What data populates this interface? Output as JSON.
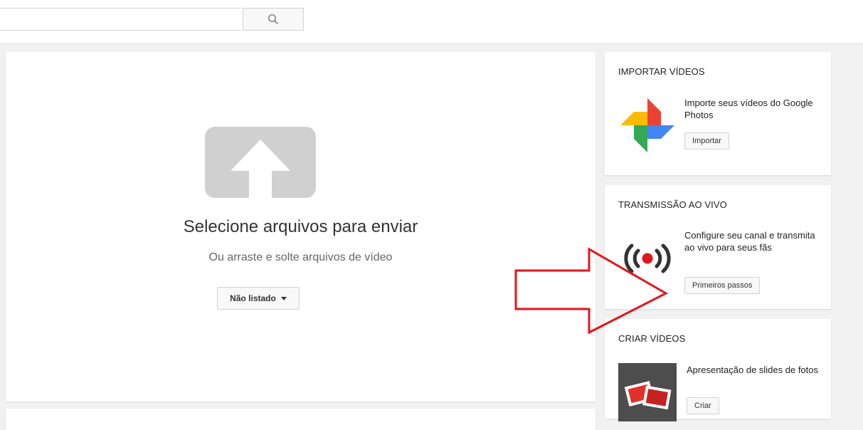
{
  "search": {
    "placeholder": "",
    "value": ""
  },
  "upload": {
    "title": "Selecione arquivos para enviar",
    "subtitle": "Ou arraste e solte arquivos de vídeo",
    "privacy_label": "Não listado"
  },
  "cards": {
    "import": {
      "title": "IMPORTAR VÍDEOS",
      "text": "Importe seus vídeos do Google Photos",
      "button": "Importar"
    },
    "live": {
      "title": "TRANSMISSÃO AO VIVO",
      "text": "Configure seu canal e transmita ao vivo para seus fãs",
      "button": "Primeiros passos"
    },
    "create": {
      "title": "CRIAR VÍDEOS",
      "text": "Apresentação de slides de fotos",
      "button": "Criar"
    }
  },
  "icons": {
    "search": "search-icon",
    "upload": "upload-arrow-icon",
    "photos": "google-photos-pinwheel-icon",
    "live": "live-broadcast-icon",
    "slideshow": "photo-slideshow-icon",
    "annotation": "red-arrow-annotation"
  },
  "colors": {
    "annotation_red": "#e3161c",
    "live_red": "#e3161c",
    "upload_icon_gray": "#d0d0d0"
  }
}
